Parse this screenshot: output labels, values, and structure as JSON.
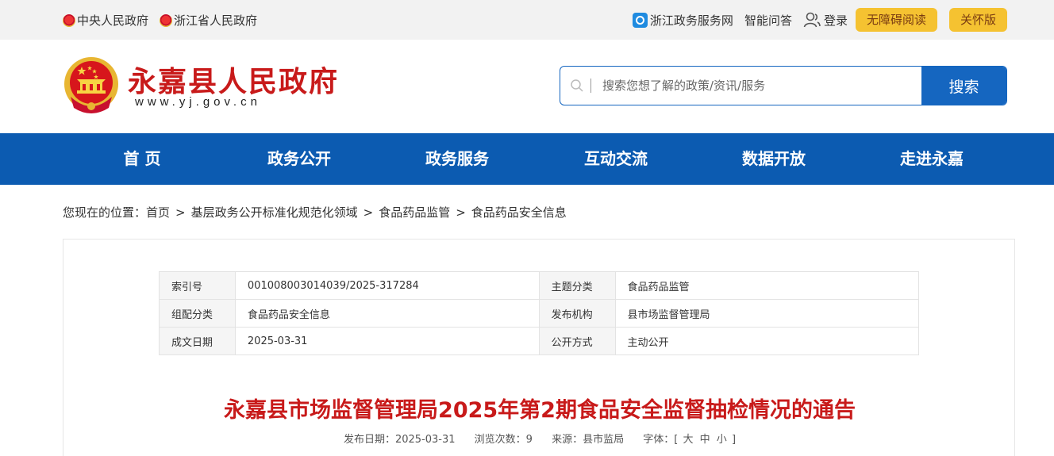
{
  "topbar": {
    "links": [
      "中央人民政府",
      "浙江省人民政府"
    ],
    "service_net": "浙江政务服务网",
    "smart_qa": "智能问答",
    "login": "登录",
    "accessible": "无障碍阅读",
    "care": "关怀版"
  },
  "header": {
    "title": "永嘉县人民政府",
    "url": "www.yj.gov.cn",
    "search_placeholder": "搜索您想了解的政策/资讯/服务",
    "search_button": "搜索"
  },
  "nav": [
    "首 页",
    "政务公开",
    "政务服务",
    "互动交流",
    "数据开放",
    "走进永嘉"
  ],
  "breadcrumb": {
    "prefix": "您现在的位置：",
    "items": [
      "首页",
      "基层政务公开标准化规范化领域",
      "食品药品监管",
      "食品药品安全信息"
    ],
    "separator": ">"
  },
  "info": [
    {
      "k1": "索引号",
      "v1": "001008003014039/2025-317284",
      "k2": "主题分类",
      "v2": "食品药品监管"
    },
    {
      "k1": "组配分类",
      "v1": "食品药品安全信息",
      "k2": "发布机构",
      "v2": "县市场监督管理局"
    },
    {
      "k1": "成文日期",
      "v1": "2025-03-31",
      "k2": "公开方式",
      "v2": "主动公开"
    }
  ],
  "article": {
    "title": "永嘉县市场监督管理局2025年第2期食品安全监督抽检情况的通告",
    "date": "发布日期：2025-03-31",
    "views": "浏览次数：9",
    "source": "来源：县市监局",
    "font_label": "字体：[",
    "font_large": "大",
    "font_medium": "中",
    "font_small": "小",
    "font_end": "]"
  },
  "colors": {
    "brand_red": "#c81a1a",
    "nav_blue": "#0c5bb1",
    "search_blue": "#1566c0",
    "pill_yellow": "#f5c231"
  }
}
